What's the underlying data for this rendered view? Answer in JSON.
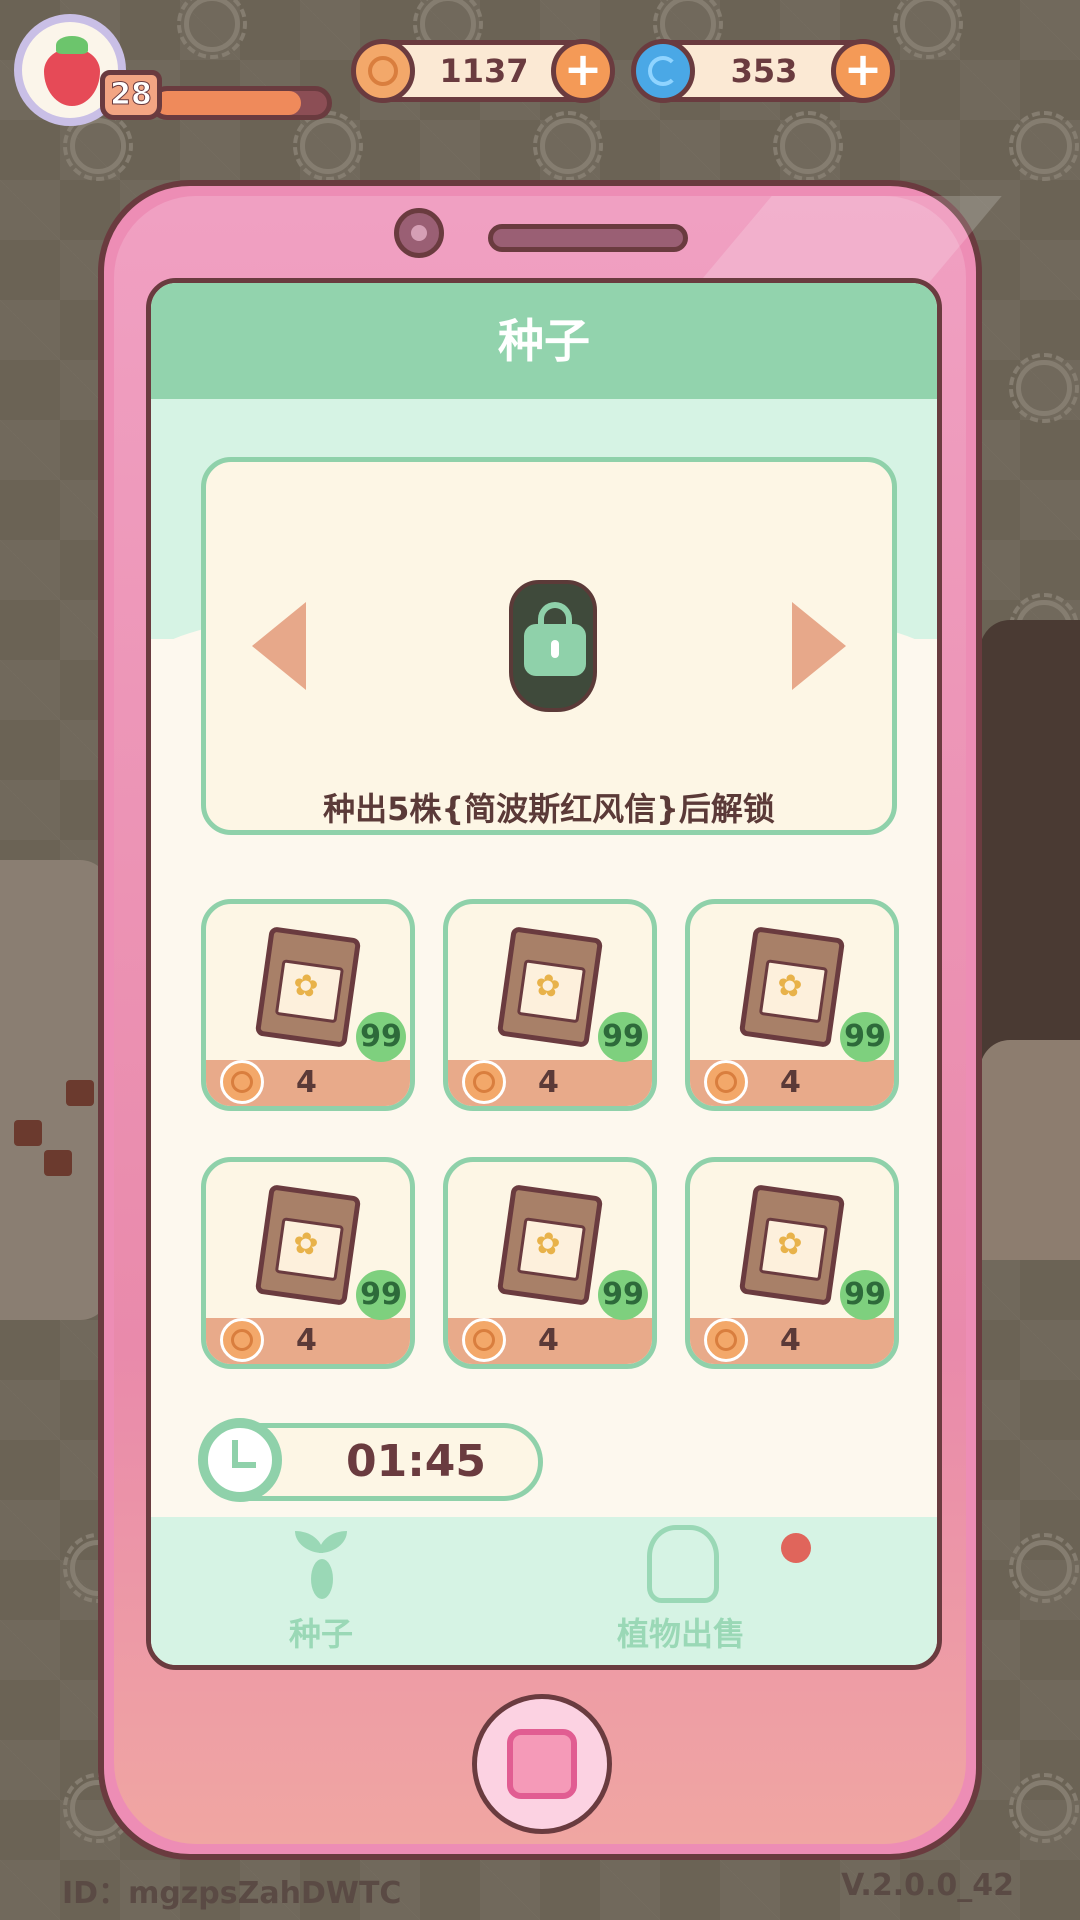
{
  "hud": {
    "level": "28",
    "xp_fraction": 0.85,
    "coins": "1137",
    "gems": "353"
  },
  "screen": {
    "title": "种子",
    "unlock_hint": "种出5株{简波斯红风信}后解锁"
  },
  "seeds": [
    {
      "count": "99",
      "price": "4"
    },
    {
      "count": "99",
      "price": "4"
    },
    {
      "count": "99",
      "price": "4"
    },
    {
      "count": "99",
      "price": "4"
    },
    {
      "count": "99",
      "price": "4"
    },
    {
      "count": "99",
      "price": "4"
    }
  ],
  "timer": "01:45",
  "tabs": [
    {
      "label": "种子",
      "icon": "sprout-icon"
    },
    {
      "label": "植物出售",
      "icon": "flower-icon",
      "has_notification": true
    }
  ],
  "footer": {
    "id": "ID：mgzpsZahDWTC",
    "version": "V.2.0.0_42"
  },
  "colors": {
    "accent_green": "#92d3ad",
    "phone_pink": "#ed8db5",
    "outline": "#6a3b3f"
  }
}
